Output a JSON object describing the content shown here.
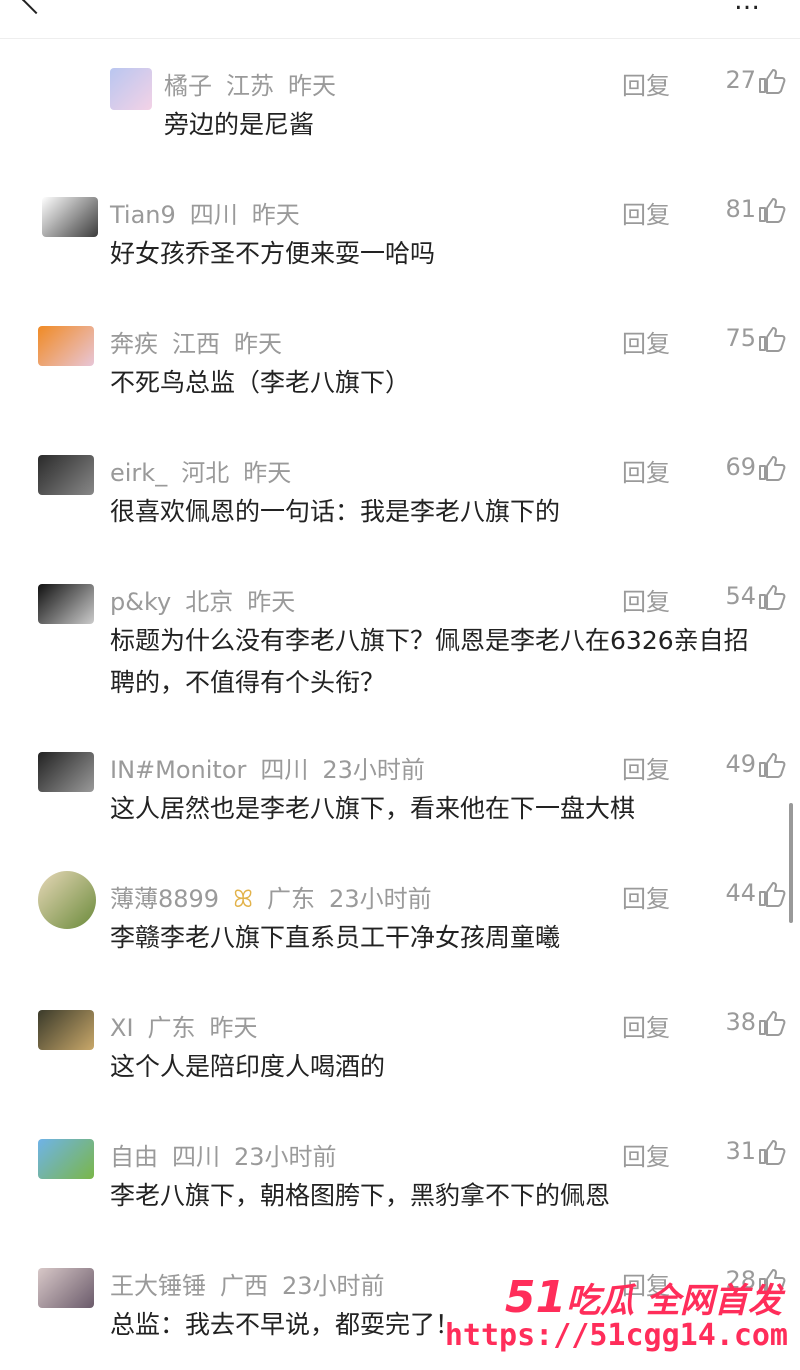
{
  "comments": [
    {
      "user": "橘子",
      "region": "江苏",
      "time": "昨天",
      "reply": "回复",
      "likes": "27",
      "text": "旁边的是尼酱",
      "avatar_color": "#b9c6f0",
      "avatar_color2": "#f3d2e6"
    },
    {
      "user": "Tian9",
      "region": "四川",
      "time": "昨天",
      "reply": "回复",
      "likes": "81",
      "text": "好女孩乔圣不方便来耍一哈吗",
      "avatar_color": "#ffffff",
      "avatar_color2": "#3b3b3b"
    },
    {
      "user": "奔疾",
      "region": "江西",
      "time": "昨天",
      "reply": "回复",
      "likes": "75",
      "text": "不死鸟总监（李老八旗下）",
      "avatar_color": "#f08a24",
      "avatar_color2": "#e8c6d8"
    },
    {
      "user": "eirk_",
      "region": "河北",
      "time": "昨天",
      "reply": "回复",
      "likes": "69",
      "text": "很喜欢佩恩的一句话：我是李老八旗下的",
      "avatar_color": "#2a2a2a",
      "avatar_color2": "#888888"
    },
    {
      "user": "p&ky",
      "region": "北京",
      "time": "昨天",
      "reply": "回复",
      "likes": "54",
      "text": "标题为什么没有李老八旗下？佩恩是李老八在6326亲自招聘的，不值得有个头衔？",
      "avatar_color": "#111111",
      "avatar_color2": "#cccccc"
    },
    {
      "user": "IN#Monitor",
      "region": "四川",
      "time": "23小时前",
      "reply": "回复",
      "likes": "49",
      "text": "这人居然也是李老八旗下，看来他在下一盘大棋",
      "avatar_color": "#222222",
      "avatar_color2": "#9a9a9a"
    },
    {
      "user": "薄薄8899",
      "region": "广东",
      "time": "23小时前",
      "reply": "回复",
      "likes": "44",
      "text": "李赣李老八旗下直系员工干净女孩周童曦",
      "avatar_color": "#e7d8b8",
      "avatar_color2": "#6a8a3a"
    },
    {
      "user": "XI",
      "region": "广东",
      "time": "昨天",
      "reply": "回复",
      "likes": "38",
      "text": "这个人是陪印度人喝酒的",
      "avatar_color": "#3a3a2a",
      "avatar_color2": "#c9a86a"
    },
    {
      "user": "自由",
      "region": "四川",
      "time": "23小时前",
      "reply": "回复",
      "likes": "31",
      "text": "李老八旗下，朝格图胯下，黑豹拿不下的佩恩",
      "avatar_color": "#6fb3e8",
      "avatar_color2": "#7ab648"
    },
    {
      "user": "王大锤锤",
      "region": "广西",
      "time": "23小时前",
      "reply": "回复",
      "likes": "28",
      "text": "总监：我去不早说，都耍完了！",
      "avatar_color": "#d8c8c8",
      "avatar_color2": "#6a5a6a"
    }
  ],
  "badge_icon": "butterfly-icon",
  "watermark": {
    "title_num": "51",
    "title_rest": "吃瓜 全网首发",
    "url": "https://51cgg14.com"
  },
  "colors": {
    "meta": "#9a9a9a",
    "text": "#222222",
    "watermark": "#ff2d5a"
  }
}
